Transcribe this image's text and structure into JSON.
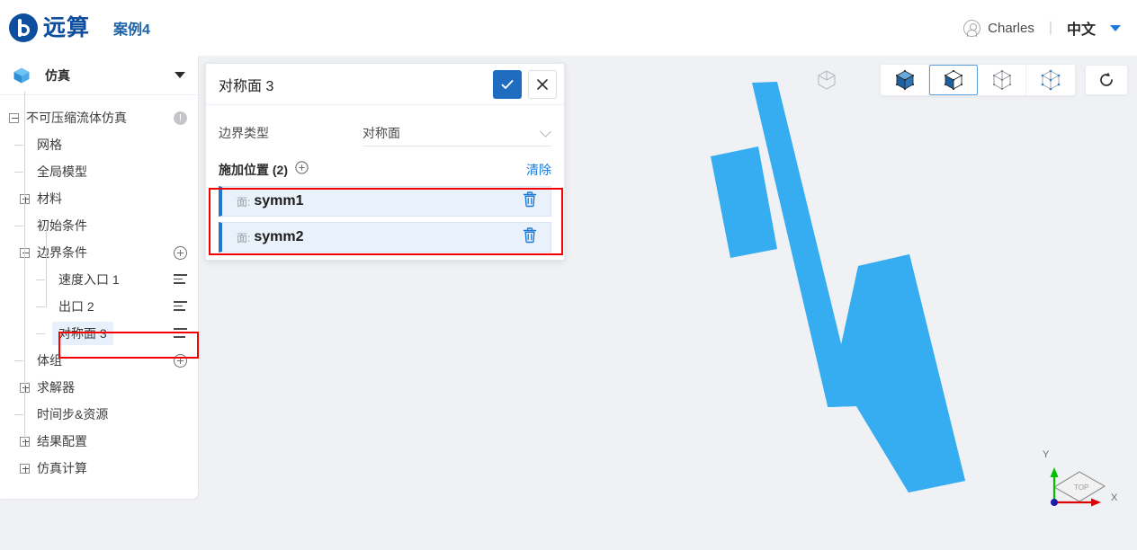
{
  "header": {
    "brand_name": "远算",
    "project_name": "案例4",
    "user_name": "Charles",
    "divider": "|",
    "language": "中文",
    "icons": {
      "user": "user-circle-icon",
      "caret": "chevron-down-icon"
    },
    "brand_color": "#0d4f9e"
  },
  "sidebar": {
    "panel_title": "仿真",
    "panel_icon": "cube-icon",
    "tree": [
      {
        "label": "不可压缩流体仿真",
        "depth": 0,
        "toggle": "minus",
        "action": "warning-icon",
        "selected": false
      },
      {
        "label": "网格",
        "depth": 1,
        "toggle": "leaf",
        "action": "none",
        "selected": false
      },
      {
        "label": "全局模型",
        "depth": 1,
        "toggle": "leaf",
        "action": "none",
        "selected": false
      },
      {
        "label": "材料",
        "depth": 1,
        "toggle": "plus",
        "action": "none",
        "selected": false
      },
      {
        "label": "初始条件",
        "depth": 1,
        "toggle": "leaf",
        "action": "none",
        "selected": false
      },
      {
        "label": "边界条件",
        "depth": 1,
        "toggle": "minus",
        "action": "plus-icon",
        "selected": false
      },
      {
        "label": "速度入口 1",
        "depth": 2,
        "toggle": "leaf",
        "action": "menu-icon",
        "selected": false
      },
      {
        "label": "出口 2",
        "depth": 2,
        "toggle": "leaf",
        "action": "menu-icon",
        "selected": false
      },
      {
        "label": "对称面 3",
        "depth": 2,
        "toggle": "leaf",
        "action": "menu-icon",
        "selected": true
      },
      {
        "label": "体组",
        "depth": 1,
        "toggle": "leaf",
        "action": "plus-icon",
        "selected": false
      },
      {
        "label": "求解器",
        "depth": 1,
        "toggle": "plus",
        "action": "none",
        "selected": false
      },
      {
        "label": "时间步&资源",
        "depth": 1,
        "toggle": "leaf",
        "action": "none",
        "selected": false
      },
      {
        "label": "结果配置",
        "depth": 1,
        "toggle": "plus",
        "action": "none",
        "selected": false
      },
      {
        "label": "仿真计算",
        "depth": 1,
        "toggle": "plus",
        "action": "none",
        "selected": false
      }
    ],
    "highlight_color": "#f50000"
  },
  "dialog": {
    "title": "对称面 3",
    "confirm_icon": "check-icon",
    "cancel_icon": "close-icon",
    "boundary_type_label": "边界类型",
    "boundary_type_value": "对称面",
    "locations_label": "施加位置 (2)",
    "locations_add_icon": "plus-circle-icon",
    "clear_label": "清除",
    "locations": [
      {
        "prefix": "面:",
        "name": "symm1",
        "delete_icon": "trash-icon"
      },
      {
        "prefix": "面:",
        "name": "symm2",
        "delete_icon": "trash-icon"
      }
    ],
    "accent_color": "#1f6dc0"
  },
  "viewport": {
    "toolbar": {
      "standalone_icon": "cube-outline-icon",
      "buttons": [
        {
          "icon": "cube-solid-icon",
          "active": false
        },
        {
          "icon": "cube-solid-edges-icon",
          "active": true
        },
        {
          "icon": "cube-wireframe-icon",
          "active": false
        },
        {
          "icon": "cube-points-icon",
          "active": false
        }
      ],
      "refresh_icon": "reset-view-icon"
    },
    "model_color": "#35adf0",
    "background_color": "#eff1f5",
    "axis_gizmo": {
      "face_label": "TOP",
      "x_label": "X",
      "y_label": "Y",
      "x_color": "#e00000",
      "y_color": "#00c000",
      "origin_color": "#1a1aaa"
    }
  }
}
